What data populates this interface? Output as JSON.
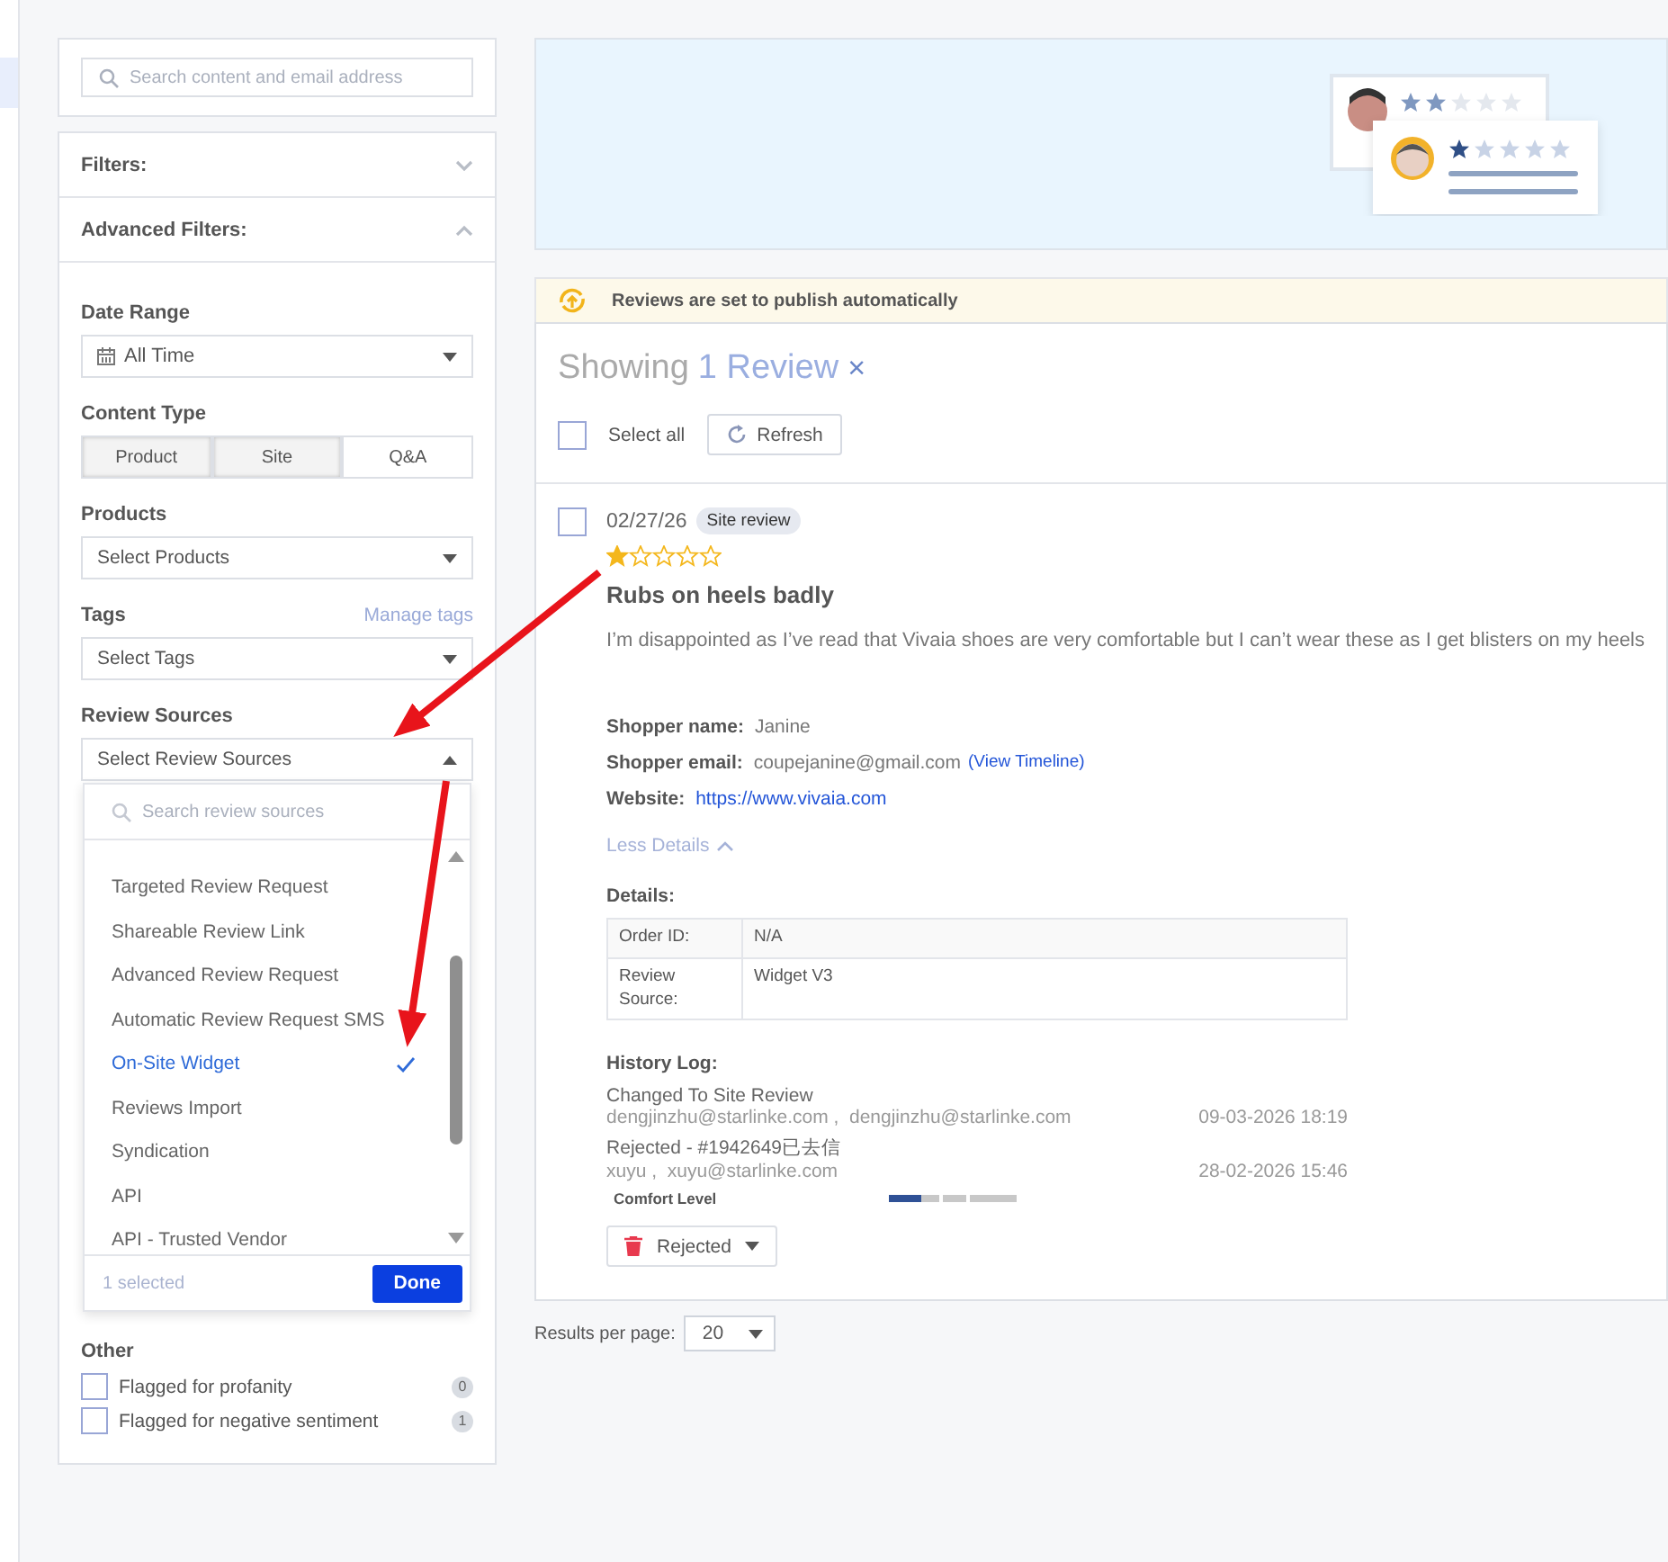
{
  "sidebar": {
    "search": {
      "placeholder": "Search content and email address"
    },
    "sections": [
      {
        "title": "Filters:",
        "expanded": false
      },
      {
        "title": "Advanced Filters:",
        "expanded": true
      }
    ],
    "date_range": {
      "label": "Date Range",
      "value": "All Time"
    },
    "content_type": {
      "label": "Content Type",
      "options": [
        {
          "label": "Product",
          "selected": true
        },
        {
          "label": "Site",
          "selected": true
        },
        {
          "label": "Q&A",
          "selected": false
        }
      ]
    },
    "products": {
      "label": "Products",
      "placeholder": "Select Products"
    },
    "tags": {
      "label": "Tags",
      "link": "Manage tags",
      "placeholder": "Select Tags"
    },
    "review_sources": {
      "label": "Review Sources",
      "placeholder": "Select Review Sources",
      "expanded": true,
      "dropdown": {
        "search_placeholder": "Search review sources",
        "items": [
          {
            "label": "Targeted Review Request",
            "selected": false
          },
          {
            "label": "Shareable Review Link",
            "selected": false
          },
          {
            "label": "Advanced Review Request",
            "selected": false
          },
          {
            "label": "Automatic Review Request SMS",
            "selected": false
          },
          {
            "label": "On-Site Widget",
            "selected": true
          },
          {
            "label": "Reviews Import",
            "selected": false
          },
          {
            "label": "Syndication",
            "selected": false
          },
          {
            "label": "API",
            "selected": false
          },
          {
            "label": "API - Trusted Vendor",
            "selected": false
          }
        ],
        "count": "1 selected",
        "done": "Done"
      }
    },
    "other": {
      "label": "Other",
      "items": [
        {
          "label": "Flagged for profanity",
          "checked": false,
          "count": "0"
        },
        {
          "label": "Flagged for negative sentiment",
          "checked": false,
          "count": "1"
        }
      ]
    }
  },
  "notice": "Reviews are set to publish automatically",
  "showing": {
    "prefix": "Showing",
    "count": "1 Review",
    "clear": "×"
  },
  "toolbar": {
    "select_all": "Select all",
    "select_all_checked": false,
    "refresh": "Refresh"
  },
  "review": {
    "checked": false,
    "date": "02/27/26",
    "tag": "Site review",
    "stars": 1,
    "title": "Rubs on heels badly",
    "body": "I’m disappointed as I’ve read that Vivaia shoes are very comfortable but I can’t wear these as I get blisters on my heels",
    "fields": [
      {
        "label": "Shopper name:",
        "value": "Janine"
      },
      {
        "label": "Shopper email:",
        "value": "coupejanine@gmail.com",
        "link": "(View Timeline)"
      },
      {
        "label": "Website:",
        "value": "https://www.vivaia.com",
        "kind": "link"
      }
    ],
    "less_details": "Less Details",
    "details_title": "Details:",
    "details": [
      {
        "label": "Order ID:",
        "value": "N/A"
      },
      {
        "label": "Review Source:",
        "value": "Widget V3"
      }
    ],
    "history_title": "History Log:",
    "history": [
      {
        "action": "Changed To Site Review",
        "users": "dengjinzhu@starlinke.com ,  dengjinzhu@starlinke.com",
        "time": "09-03-2026 18:19"
      },
      {
        "action": "Rejected - #1942649已去信",
        "users": "xuyu ,  xuyu@starlinke.com",
        "time": "28-02-2026 15:46"
      }
    ],
    "comfort": {
      "label": "Comfort Level",
      "level": 0.25
    },
    "status": "Rejected"
  },
  "pagination": {
    "label": "Results per page:",
    "value": "20"
  }
}
